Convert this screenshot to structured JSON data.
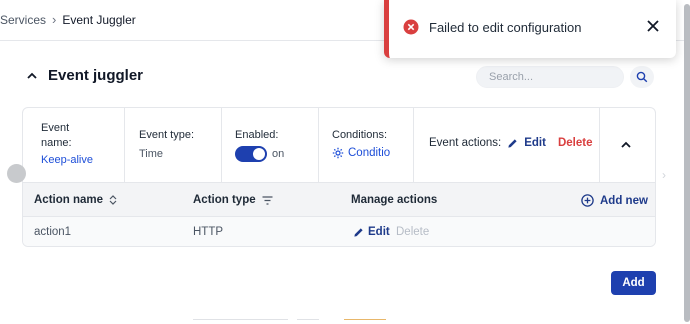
{
  "breadcrumb": {
    "parent": "Services",
    "current": "Event Juggler"
  },
  "section": {
    "title": "Event juggler"
  },
  "search": {
    "placeholder": "Search..."
  },
  "summary": {
    "event_name_label": "Event name:",
    "event_name_value": "Keep-alive",
    "event_type_label": "Event type:",
    "event_type_value": "Time",
    "enabled_label": "Enabled:",
    "enabled_state": "on",
    "conditions_label": "Conditions:",
    "conditions_value": "Conditio",
    "event_actions_label": "Event actions:",
    "edit_label": "Edit",
    "delete_label": "Delete"
  },
  "table": {
    "columns": [
      "Action name",
      "Action type",
      "Manage actions"
    ],
    "add_new_label": "Add new",
    "rows": [
      {
        "name": "action1",
        "type": "HTTP",
        "edit": "Edit",
        "delete": "Delete"
      }
    ]
  },
  "add_button": "Add",
  "toast": {
    "message": "Failed to edit configuration"
  },
  "colors": {
    "accent": "#1e40af",
    "danger": "#d93f3f",
    "link": "#1d4ed8"
  }
}
